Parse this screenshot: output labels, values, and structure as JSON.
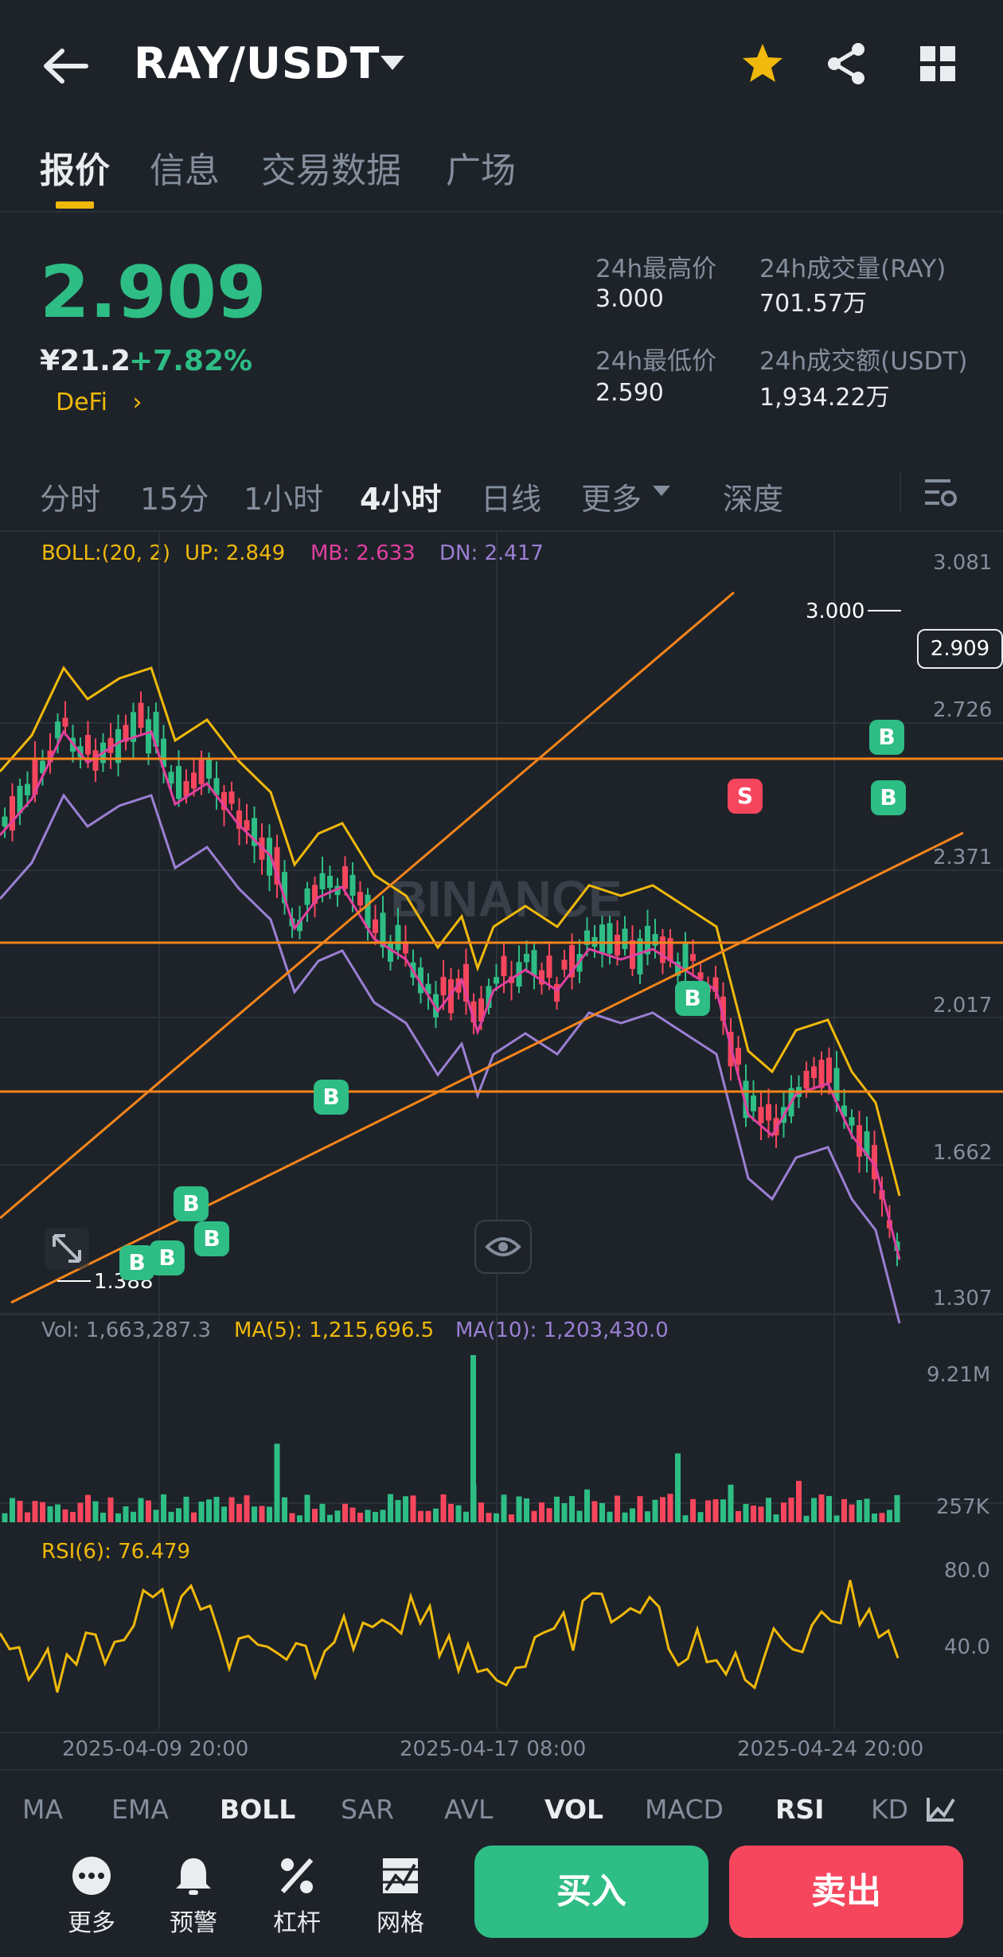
{
  "header": {
    "title": "RAY/USDT"
  },
  "tabs": [
    "报价",
    "信息",
    "交易数据",
    "广场"
  ],
  "ticker": {
    "price": "2.909",
    "cny": "¥21.2",
    "change": "+7.82%",
    "tag": "DeFi",
    "high_label": "24h最高价",
    "high": "3.000",
    "low_label": "24h最低价",
    "low": "2.590",
    "vol_label": "24h成交量(RAY)",
    "vol": "701.57万",
    "amt_label": "24h成交额(USDT)",
    "amt": "1,934.22万"
  },
  "intervals": [
    "分时",
    "15分",
    "1小时",
    "4小时",
    "日线",
    "更多",
    "深度"
  ],
  "boll": {
    "label": "BOLL:(20, 2)",
    "up": "UP: 2.849",
    "mb": "MB: 2.633",
    "dn": "DN: 2.417"
  },
  "price_axis": [
    "3.081",
    "2.726",
    "2.371",
    "2.017",
    "1.662",
    "1.307"
  ],
  "current_price_tag": "2.909",
  "max_label": "3.000",
  "min_label": "1.388",
  "watermark": "BINANCE",
  "volume": {
    "vol": "Vol: 1,663,287.3",
    "ma5": "MA(5): 1,215,696.5",
    "ma10": "MA(10): 1,203,430.0",
    "axis_top": "9.21M",
    "axis_bottom": "257K"
  },
  "rsi": {
    "label": "RSI(6): 76.479",
    "axis_top": "80.0",
    "axis_bottom": "40.0"
  },
  "dates": [
    "2025-04-09 20:00",
    "2025-04-17 08:00",
    "2025-04-24 20:00"
  ],
  "indicator_tabs": [
    "MA",
    "EMA",
    "BOLL",
    "SAR",
    "AVL",
    "VOL",
    "MACD",
    "RSI",
    "KD"
  ],
  "actions": [
    "更多",
    "预警",
    "杠杆",
    "网格"
  ],
  "buy": "买入",
  "sell": "卖出",
  "signals": {
    "buy": "B",
    "sell": "S"
  },
  "colors": {
    "bg": "#1e2329",
    "up": "#2ebd85",
    "down": "#f6465d",
    "accent": "#f0b90b",
    "boll_up": "#f0b90b",
    "boll_mb": "#e040a0",
    "boll_dn": "#9b7fd4",
    "trendline": "#f6851b"
  }
}
